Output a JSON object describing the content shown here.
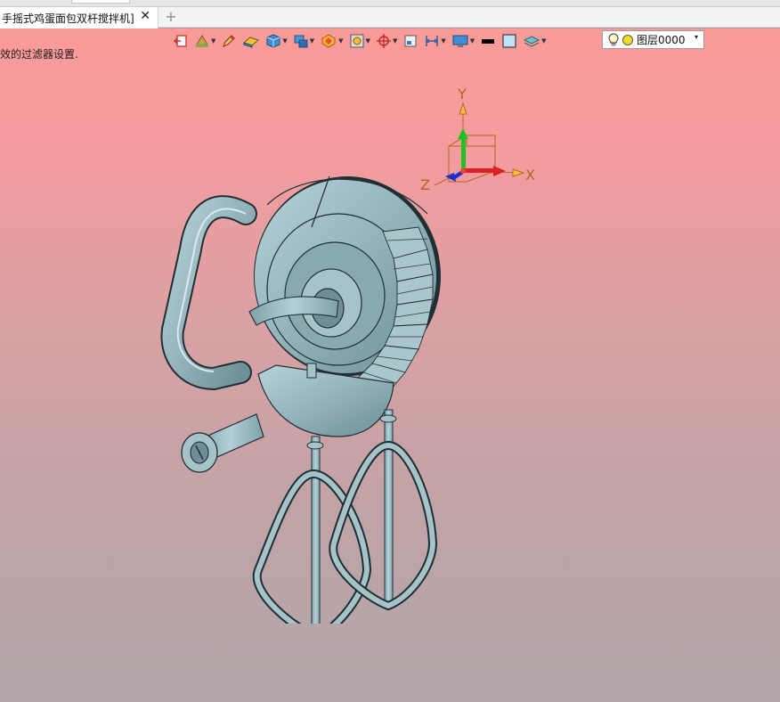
{
  "document_tab": {
    "title": "手摇式鸡蛋面包双杆搅拌机]",
    "close_glyph": "✕",
    "add_glyph": "+"
  },
  "viewport": {
    "hint_text": "效的过滤器设置.",
    "background_top": "#fb9b99",
    "background_bottom": "#b2a6a8"
  },
  "toolbar": {
    "layer_name": "图层0000",
    "layer_dropdown_glyph": "▾"
  },
  "triad": {
    "x_label": "X",
    "y_label": "Y",
    "z_label": "Z",
    "x_color": "#e02020",
    "y_color": "#22c022",
    "z_color": "#2030d0"
  },
  "model": {
    "name": "hand-crank-egg-beater",
    "color": "#93b2ba"
  }
}
